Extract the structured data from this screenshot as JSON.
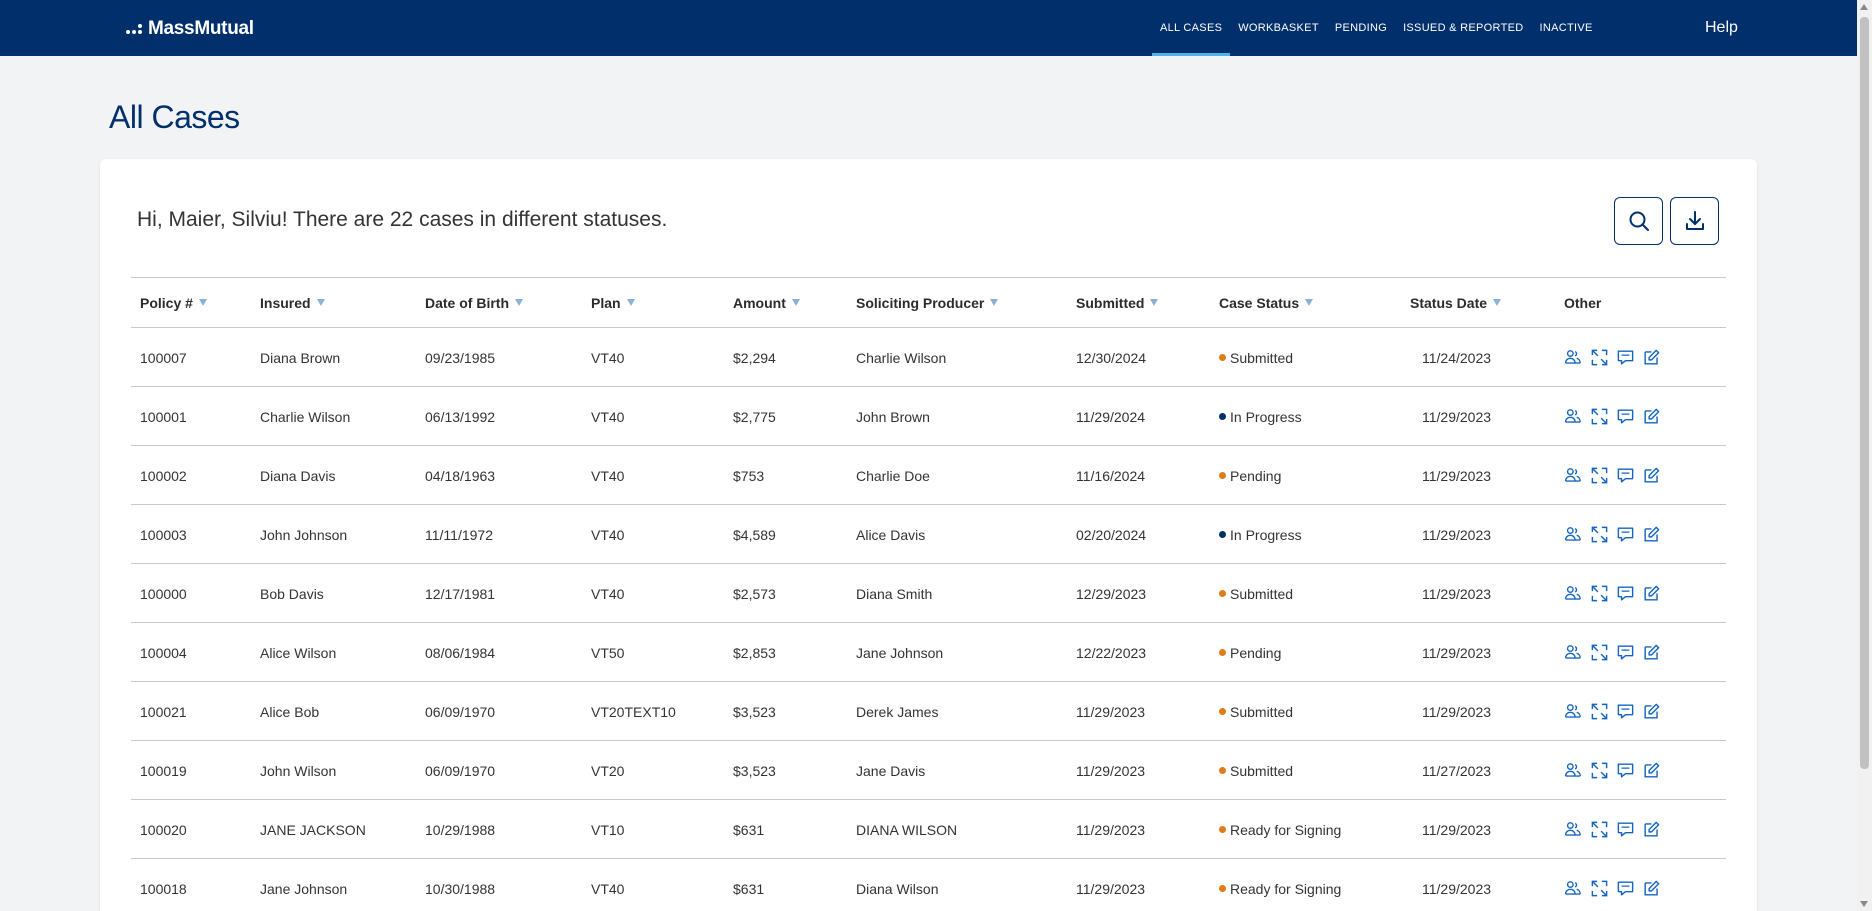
{
  "brand": {
    "name": "MassMutual"
  },
  "nav": {
    "items": [
      "ALL CASES",
      "WORKBASKET",
      "PENDING",
      "ISSUED & REPORTED",
      "INACTIVE"
    ],
    "active": "ALL CASES",
    "help": "Help"
  },
  "page": {
    "title": "All Cases",
    "greeting_prefix": "Hi, Maier, Silviu! There are ",
    "case_count": "22",
    "greeting_suffix": " cases in different statuses."
  },
  "toolbar": {
    "search_icon": "search-icon",
    "download_icon": "download-icon"
  },
  "table": {
    "columns": [
      "Policy #",
      "Insured",
      "Date of Birth",
      "Plan",
      "Amount",
      "Soliciting Producer",
      "Submitted",
      "Case Status",
      "Status Date",
      "Other"
    ],
    "rows": [
      {
        "policy": "100007",
        "insured": "Diana Brown",
        "dob": "09/23/1985",
        "plan": "VT40",
        "amount": "$2,294",
        "producer": "Charlie Wilson",
        "submitted": "12/30/2024",
        "status": "Submitted",
        "status_color": "#e07b17",
        "status_date": "11/24/2023"
      },
      {
        "policy": "100001",
        "insured": "Charlie Wilson",
        "dob": "06/13/1992",
        "plan": "VT40",
        "amount": "$2,775",
        "producer": "John Brown",
        "submitted": "11/29/2024",
        "status": "In Progress",
        "status_color": "#002f6c",
        "status_date": "11/29/2023"
      },
      {
        "policy": "100002",
        "insured": "Diana Davis",
        "dob": "04/18/1963",
        "plan": "VT40",
        "amount": "$753",
        "producer": "Charlie Doe",
        "submitted": "11/16/2024",
        "status": "Pending",
        "status_color": "#e07b17",
        "status_date": "11/29/2023"
      },
      {
        "policy": "100003",
        "insured": "John Johnson",
        "dob": "11/11/1972",
        "plan": "VT40",
        "amount": "$4,589",
        "producer": "Alice Davis",
        "submitted": "02/20/2024",
        "status": "In Progress",
        "status_color": "#002f6c",
        "status_date": "11/29/2023"
      },
      {
        "policy": "100000",
        "insured": "Bob Davis",
        "dob": "12/17/1981",
        "plan": "VT40",
        "amount": "$2,573",
        "producer": "Diana Smith",
        "submitted": "12/29/2023",
        "status": "Submitted",
        "status_color": "#e07b17",
        "status_date": "11/29/2023"
      },
      {
        "policy": "100004",
        "insured": "Alice Wilson",
        "dob": "08/06/1984",
        "plan": "VT50",
        "amount": "$2,853",
        "producer": "Jane Johnson",
        "submitted": "12/22/2023",
        "status": "Pending",
        "status_color": "#e07b17",
        "status_date": "11/29/2023"
      },
      {
        "policy": "100021",
        "insured": "Alice Bob",
        "dob": "06/09/1970",
        "plan": "VT20TEXT10",
        "amount": "$3,523",
        "producer": "Derek James",
        "submitted": "11/29/2023",
        "status": "Submitted",
        "status_color": "#e07b17",
        "status_date": "11/29/2023"
      },
      {
        "policy": "100019",
        "insured": "John Wilson",
        "dob": "06/09/1970",
        "plan": "VT20",
        "amount": "$3,523",
        "producer": "Jane Davis",
        "submitted": "11/29/2023",
        "status": "Submitted",
        "status_color": "#e07b17",
        "status_date": "11/27/2023"
      },
      {
        "policy": "100020",
        "insured": "JANE JACKSON",
        "dob": "10/29/1988",
        "plan": "VT10",
        "amount": "$631",
        "producer": "DIANA WILSON",
        "submitted": "11/29/2023",
        "status": "Ready for Signing",
        "status_color": "#e07b17",
        "status_date": "11/29/2023"
      },
      {
        "policy": "100018",
        "insured": "Jane Johnson",
        "dob": "10/30/1988",
        "plan": "VT40",
        "amount": "$631",
        "producer": "Diana Wilson",
        "submitted": "11/29/2023",
        "status": "Ready for Signing",
        "status_color": "#e07b17",
        "status_date": "11/29/2023"
      }
    ],
    "row_actions": [
      "people-icon",
      "expand-icon",
      "message-icon",
      "edit-icon"
    ]
  },
  "colors": {
    "brand_navy": "#002f6c",
    "accent_blue": "#4db3e6",
    "action_blue": "#1565c0"
  }
}
